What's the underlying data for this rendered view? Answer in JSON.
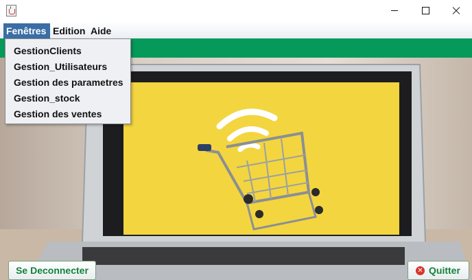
{
  "window": {
    "app_icon": "java-cup-icon",
    "controls": [
      "minimize-icon",
      "maximize-icon",
      "close-icon"
    ]
  },
  "menu": {
    "items": [
      {
        "label": "Fenêtres",
        "active": true
      },
      {
        "label": "Edition"
      },
      {
        "label": "Aide"
      }
    ],
    "dropdown": [
      {
        "label": "GestionClients"
      },
      {
        "label": "Gestion_Utilisateurs"
      },
      {
        "label": "Gestion des parametres"
      },
      {
        "label": "Gestion_stock"
      },
      {
        "label": "Gestion des ventes"
      }
    ]
  },
  "colors": {
    "menu_highlight": "#3a6ea5",
    "green_bar": "#05995a",
    "button_text": "#11823b",
    "quit_icon": "#d9342b",
    "screen_yellow": "#f3d53f"
  },
  "footer": {
    "disconnect_label": "Se Deconnecter",
    "quit_label": "Quitter",
    "quit_icon": "close-circle-icon"
  }
}
